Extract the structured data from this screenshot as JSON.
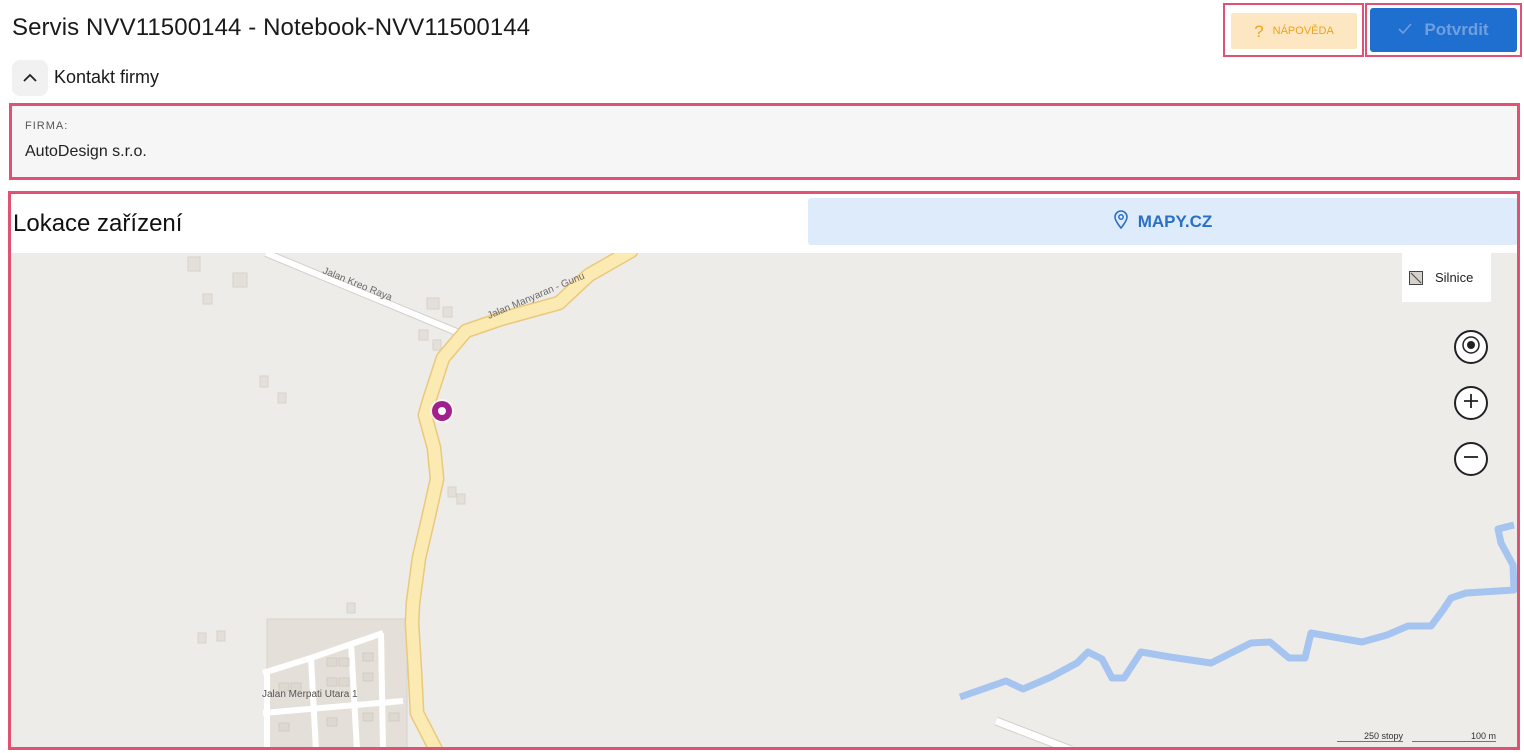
{
  "header": {
    "title": "Servis NVV11500144 - Notebook-NVV11500144",
    "help_label": "NÁPOVĚDA",
    "confirm_label": "Potvrdit"
  },
  "contact": {
    "section_label": "Kontakt firmy",
    "firm_label": "FIRMA:",
    "firm_value": "AutoDesign s.r.o."
  },
  "location": {
    "heading": "Lokace zařízení",
    "mapy_label": "MAPY.CZ"
  },
  "map": {
    "layer_label": "Silnice",
    "streets": [
      "Jalan Kreo Raya",
      "Jalan Manyaran - Gunu",
      "Jalan Merpati Utara 1"
    ],
    "scale_feet": "250 stopy",
    "scale_meters": "100 m",
    "colors": {
      "background": "#eeece9",
      "main_road": "#fbeab1",
      "river": "#a6c4f0",
      "marker": "#a0208e"
    }
  },
  "colors": {
    "highlight_border": "#e05274",
    "primary": "#1f6fd1",
    "help_bg": "#fde7c3"
  }
}
